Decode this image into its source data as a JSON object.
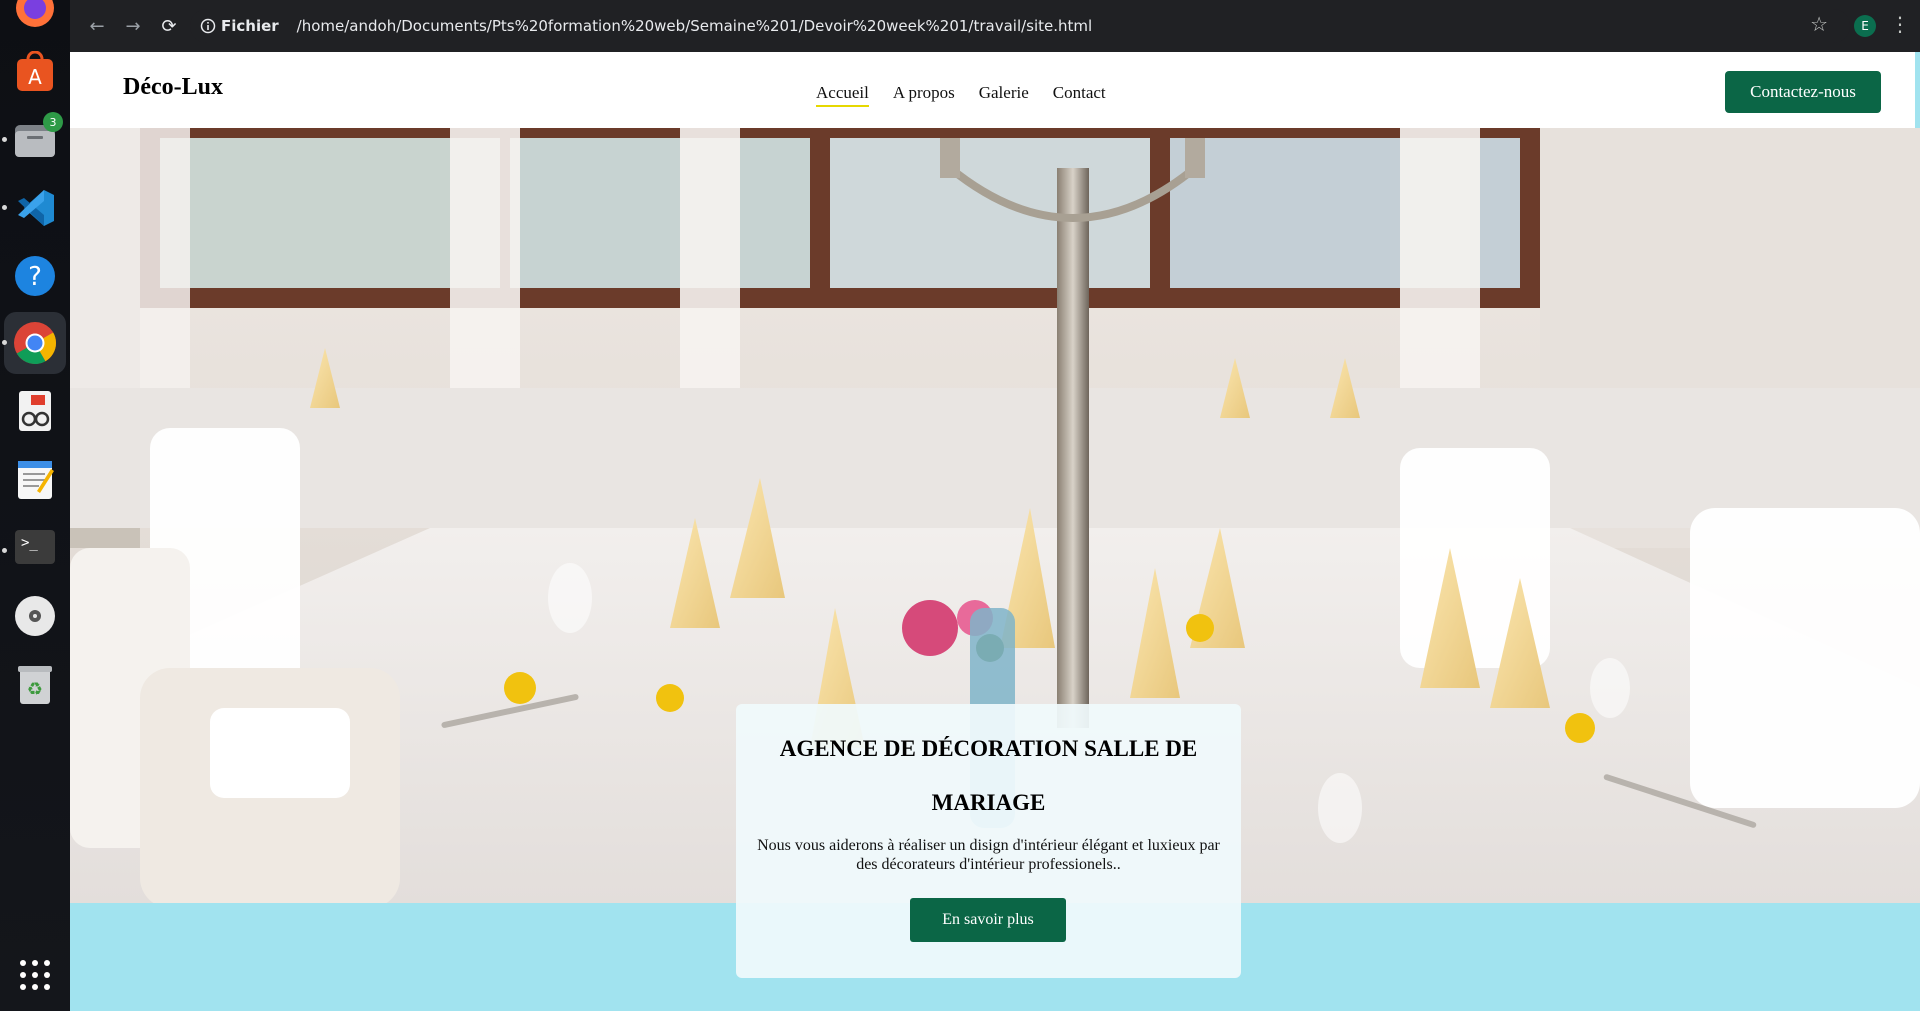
{
  "dock": {
    "apps": [
      {
        "name": "firefox-icon"
      },
      {
        "name": "app-center-icon"
      },
      {
        "name": "files-icon",
        "badge": "3"
      },
      {
        "name": "vscode-icon"
      },
      {
        "name": "help-icon"
      },
      {
        "name": "chrome-icon"
      },
      {
        "name": "document-viewer-icon"
      },
      {
        "name": "text-editor-icon"
      },
      {
        "name": "terminal-icon"
      },
      {
        "name": "disc-icon"
      },
      {
        "name": "trash-icon"
      },
      {
        "name": "app-grid-icon"
      }
    ]
  },
  "browser": {
    "site_info_label": "Fichier",
    "url": "/home/andoh/Documents/Pts%20formation%20web/Semaine%201/Devoir%20week%201/travail/site.html",
    "profile_initial": "E"
  },
  "site": {
    "logo": "Déco-Lux",
    "nav": {
      "home": "Accueil",
      "about": "A propos",
      "gallery": "Galerie",
      "contact": "Contact"
    },
    "contact_button": "Contactez-nous",
    "hero": {
      "title": "AGENCE DE DÉCORATION SALLE DE MARIAGE",
      "description": "Nous vous aiderons à réaliser un disign d'intérieur élégant et luxieux par des décorateurs d'intérieur professionels..",
      "button": "En savoir plus"
    }
  },
  "colors": {
    "brand_green": "#0b6646",
    "page_background": "#a1e3ef",
    "nav_active_underline": "#e6d800"
  }
}
